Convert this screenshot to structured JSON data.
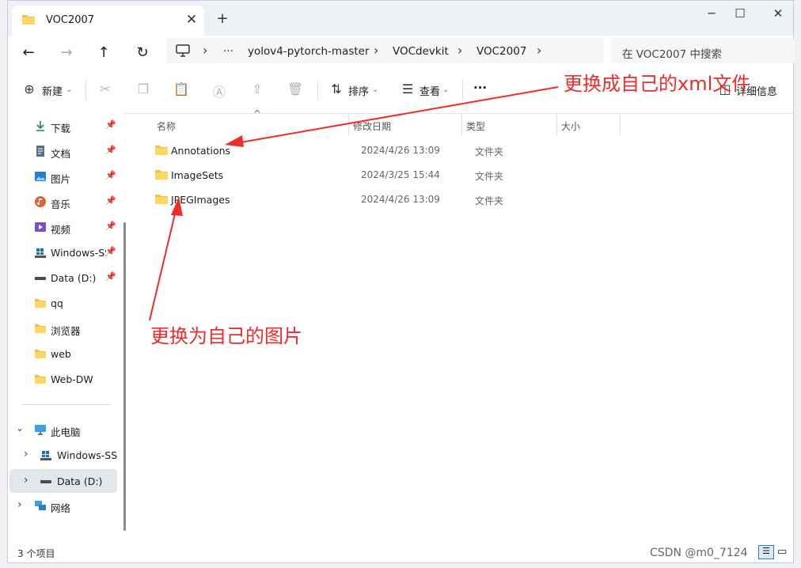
{
  "window": {
    "tab_title": "VOC2007",
    "new_tab": "+",
    "controls": {
      "minimize": "─",
      "maximize": "☐",
      "close": "✕"
    }
  },
  "addressbar": {
    "breadcrumb": [
      "yolov4-pytorch-master",
      "VOCdevkit",
      "VOC2007"
    ],
    "more": "···",
    "search_placeholder": "在 VOC2007 中搜索"
  },
  "commandbar": {
    "new_label": "新建",
    "sort_label": "排序",
    "view_label": "查看",
    "more_label": "···",
    "details_label": "详细信息",
    "icons": [
      "cut-icon",
      "copy-icon",
      "paste-icon",
      "rename-icon",
      "share-icon",
      "delete-icon"
    ]
  },
  "sidebar": {
    "quick_access": [
      {
        "label": "下载",
        "icon": "download-icon",
        "pinned": true
      },
      {
        "label": "文档",
        "icon": "document-icon",
        "pinned": true
      },
      {
        "label": "图片",
        "icon": "pictures-icon",
        "pinned": true
      },
      {
        "label": "音乐",
        "icon": "music-icon",
        "pinned": true
      },
      {
        "label": "视频",
        "icon": "video-icon",
        "pinned": true
      },
      {
        "label": "Windows-SSD",
        "icon": "drive-windows-icon",
        "pinned": true
      },
      {
        "label": "Data (D:)",
        "icon": "drive-icon",
        "pinned": true
      },
      {
        "label": "qq",
        "icon": "folder-icon",
        "pinned": false
      },
      {
        "label": "浏览器",
        "icon": "folder-icon",
        "pinned": false
      },
      {
        "label": "web",
        "icon": "folder-icon",
        "pinned": false
      },
      {
        "label": "Web-DW",
        "icon": "folder-icon",
        "pinned": false
      }
    ],
    "this_pc": "此电脑",
    "drives": [
      "Windows-SSD",
      "Data (D:)"
    ],
    "network": "网络"
  },
  "list": {
    "columns": [
      "名称",
      "修改日期",
      "类型",
      "大小"
    ],
    "rows": [
      {
        "name": "Annotations",
        "date": "2024/4/26 13:09",
        "type": "文件夹"
      },
      {
        "name": "ImageSets",
        "date": "2024/3/25 15:44",
        "type": "文件夹"
      },
      {
        "name": "JPEGImages",
        "date": "2024/4/26 13:09",
        "type": "文件夹"
      }
    ]
  },
  "status": {
    "count": "3 个项目"
  },
  "annotations": {
    "xml_note": "更换成自己的xml文件",
    "image_note": "更换为自己的图片",
    "color": "#ee2c2c"
  },
  "watermark": "CSDN @m0_7124"
}
